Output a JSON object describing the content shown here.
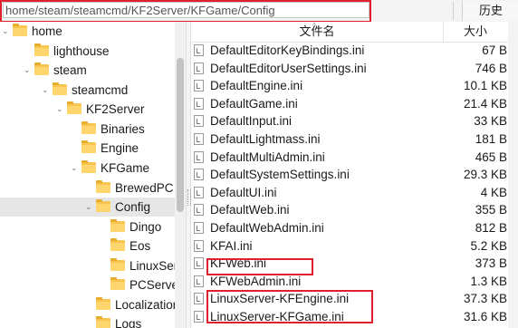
{
  "address_bar": {
    "path": "home/steam/steamcmd/KF2Server/KFGame/Config",
    "history_label": "历史"
  },
  "tree": {
    "items": [
      {
        "label": "home",
        "expanded": true
      },
      {
        "label": "lighthouse",
        "expanded": false
      },
      {
        "label": "steam",
        "expanded": true
      },
      {
        "label": "steamcmd",
        "expanded": true
      },
      {
        "label": "KF2Server",
        "expanded": true
      },
      {
        "label": "Binaries",
        "expanded": false
      },
      {
        "label": "Engine",
        "expanded": false
      },
      {
        "label": "KFGame",
        "expanded": true
      },
      {
        "label": "BrewedPC",
        "expanded": false
      },
      {
        "label": "Config",
        "expanded": true,
        "selected": true
      },
      {
        "label": "Dingo",
        "expanded": false
      },
      {
        "label": "Eos",
        "expanded": false
      },
      {
        "label": "LinuxServ",
        "expanded": false
      },
      {
        "label": "PCServer",
        "expanded": false
      },
      {
        "label": "Localization",
        "expanded": false
      },
      {
        "label": "Logs",
        "expanded": false
      }
    ]
  },
  "file_list": {
    "columns": {
      "name": "文件名",
      "size": "大小"
    },
    "rows": [
      {
        "name": "DefaultEditorKeyBindings.ini",
        "size": "67 B"
      },
      {
        "name": "DefaultEditorUserSettings.ini",
        "size": "746 B"
      },
      {
        "name": "DefaultEngine.ini",
        "size": "10.1 KB"
      },
      {
        "name": "DefaultGame.ini",
        "size": "21.4 KB"
      },
      {
        "name": "DefaultInput.ini",
        "size": "33 KB"
      },
      {
        "name": "DefaultLightmass.ini",
        "size": "181 B"
      },
      {
        "name": "DefaultMultiAdmin.ini",
        "size": "465 B"
      },
      {
        "name": "DefaultSystemSettings.ini",
        "size": "29.3 KB"
      },
      {
        "name": "DefaultUI.ini",
        "size": "4 KB"
      },
      {
        "name": "DefaultWeb.ini",
        "size": "355 B"
      },
      {
        "name": "DefaultWebAdmin.ini",
        "size": "812 B"
      },
      {
        "name": "KFAI.ini",
        "size": "5.2 KB"
      },
      {
        "name": "KFWeb.ini",
        "size": "373 B"
      },
      {
        "name": "KFWebAdmin.ini",
        "size": "1.3 KB"
      },
      {
        "name": "LinuxServer-KFEngine.ini",
        "size": "37.3 KB"
      },
      {
        "name": "LinuxServer-KFGame.ini",
        "size": "31.6 KB"
      }
    ]
  },
  "colors": {
    "highlight": "#e0202e",
    "folder": "#f8c550",
    "selected_row": "#e6e6e6"
  }
}
